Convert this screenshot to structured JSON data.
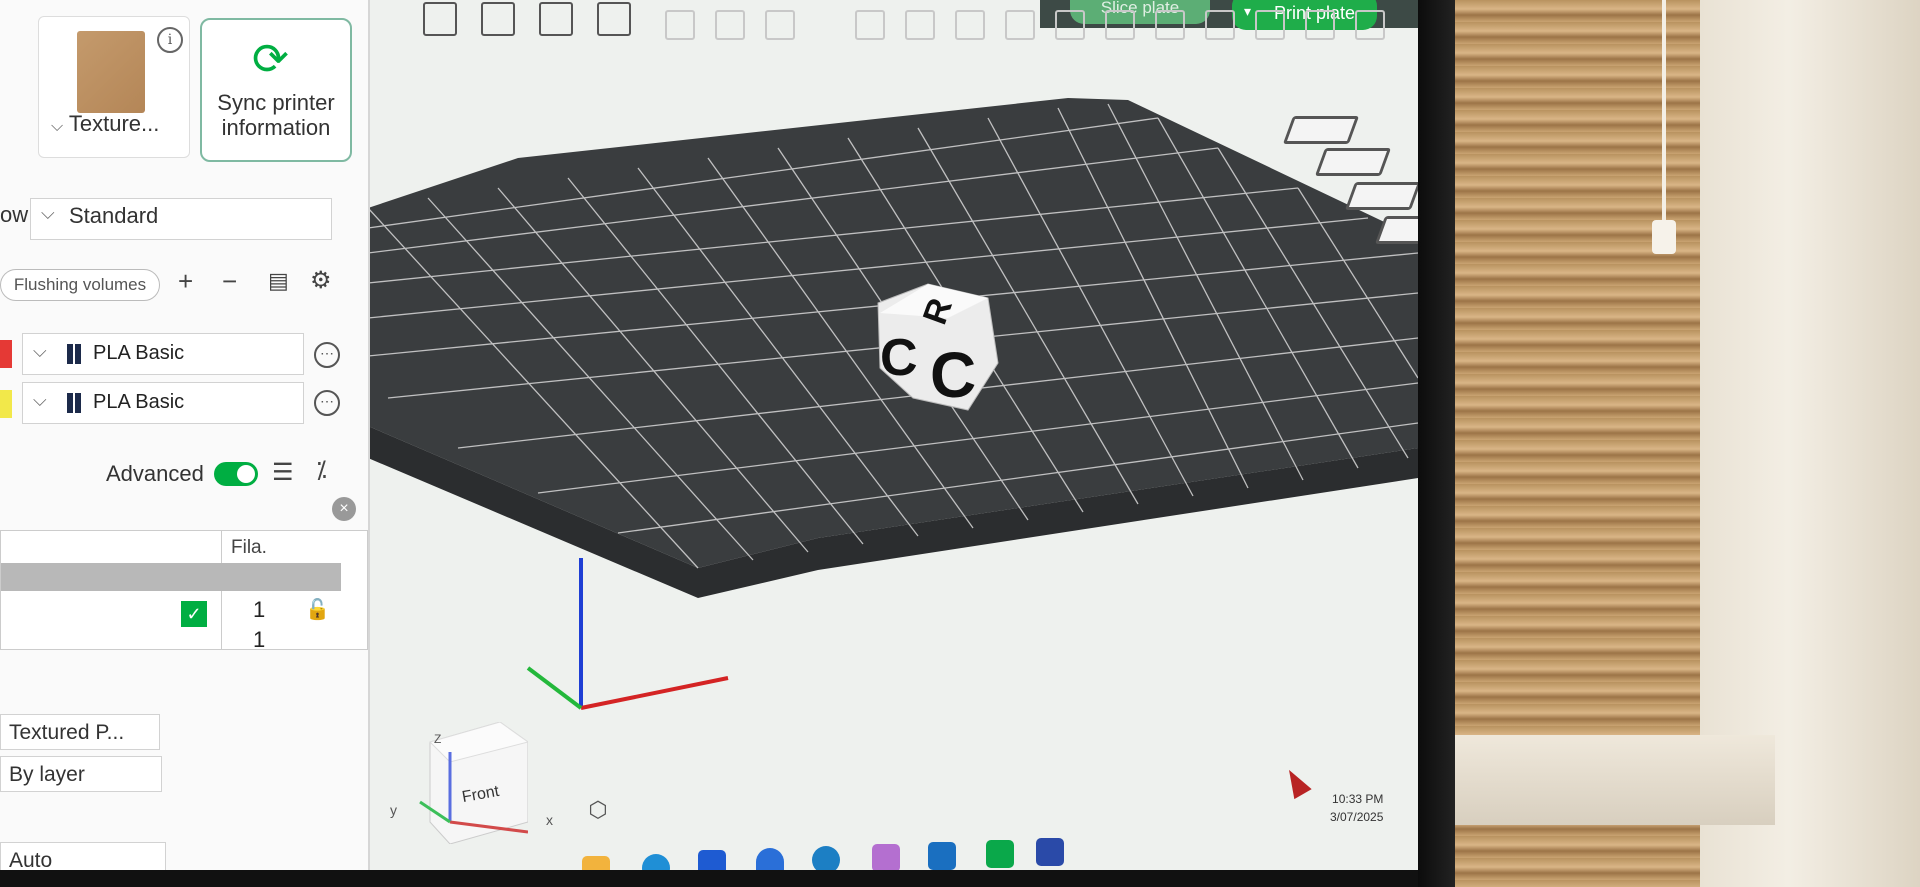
{
  "plate": {
    "thumbnail_label": "Texture...",
    "info_icon": "i",
    "sync_button": "Sync printer information",
    "sync_icon": "⟳"
  },
  "process": {
    "flow_label": "ow",
    "preset": "Standard"
  },
  "filament": {
    "flushing_button": "Flushing volumes",
    "add_icon": "+",
    "remove_icon": "−",
    "items": [
      {
        "name": "PLA Basic",
        "color": "#e53935"
      },
      {
        "name": "PLA Basic",
        "color": "#f2e84a"
      }
    ],
    "more_icon": "⋯"
  },
  "settings": {
    "advanced_label": "Advanced",
    "advanced_on": true,
    "list_icon": "☰",
    "compare_icon": "⁒"
  },
  "object_table": {
    "column_header": "Fila.",
    "row_value_1": "1",
    "row_value_2": "1",
    "check_icon": "✓",
    "lock_icon": "🔓"
  },
  "properties": {
    "plate_type": "Textured P...",
    "sequence": "By layer",
    "mode": "Auto"
  },
  "topbar": {
    "slice_button": "Slice plate",
    "print_button": "Print plate",
    "accent_color": "#00ae42"
  },
  "viewport": {
    "model_letters": [
      "R",
      "C",
      "R"
    ],
    "view_cube_label": "Front",
    "axis_z": "Z",
    "axis_y": "y",
    "axis_x": "x"
  },
  "system_tray": {
    "time": "10:33 PM",
    "date": "3/07/2025"
  }
}
